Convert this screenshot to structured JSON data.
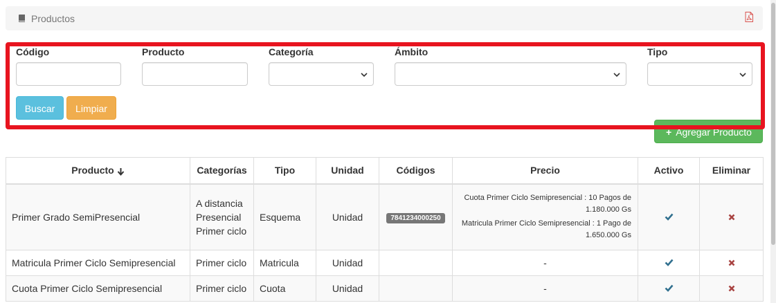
{
  "panel": {
    "title": "Productos",
    "icons": [
      "book-icon",
      "file-pdf-icon"
    ]
  },
  "filters": {
    "codigo_label": "Código",
    "producto_label": "Producto",
    "categoria_label": "Categoría",
    "ambito_label": "Ámbito",
    "tipo_label": "Tipo"
  },
  "buttons": {
    "buscar": "Buscar",
    "limpiar": "Limpiar",
    "agregar": "Agregar Producto"
  },
  "table": {
    "headers": {
      "producto": "Producto",
      "categorias": "Categorías",
      "tipo": "Tipo",
      "unidad": "Unidad",
      "codigos": "Códigos",
      "precio": "Precio",
      "activo": "Activo",
      "eliminar": "Eliminar"
    },
    "rows": [
      {
        "producto": "Primer Grado SemiPresencial",
        "categorias": [
          "A distancia",
          "Presencial",
          "Primer ciclo"
        ],
        "tipo": "Esquema",
        "unidad": "Unidad",
        "codigo": "7841234000250",
        "precio": [
          "Cuota Primer Ciclo Semipresencial : 10 Pagos de 1.180.000 Gs",
          "Matricula Primer Ciclo Semipresencial : 1 Pago de 1.650.000 Gs"
        ]
      },
      {
        "producto": "Matricula Primer Ciclo Semipresencial",
        "categorias": [
          "Primer ciclo"
        ],
        "tipo": "Matricula",
        "unidad": "Unidad",
        "codigo": "",
        "precio": [
          "-"
        ]
      },
      {
        "producto": "Cuota Primer Ciclo Semipresencial",
        "categorias": [
          "Primer ciclo"
        ],
        "tipo": "Cuota",
        "unidad": "Unidad",
        "codigo": "",
        "precio": [
          "-"
        ]
      }
    ]
  },
  "colors": {
    "info": "#5bc0de",
    "warning": "#f0ad4e",
    "success": "#5cb85c",
    "highlight": "#e8141f",
    "check": "#31708f",
    "delete": "#a94442"
  }
}
